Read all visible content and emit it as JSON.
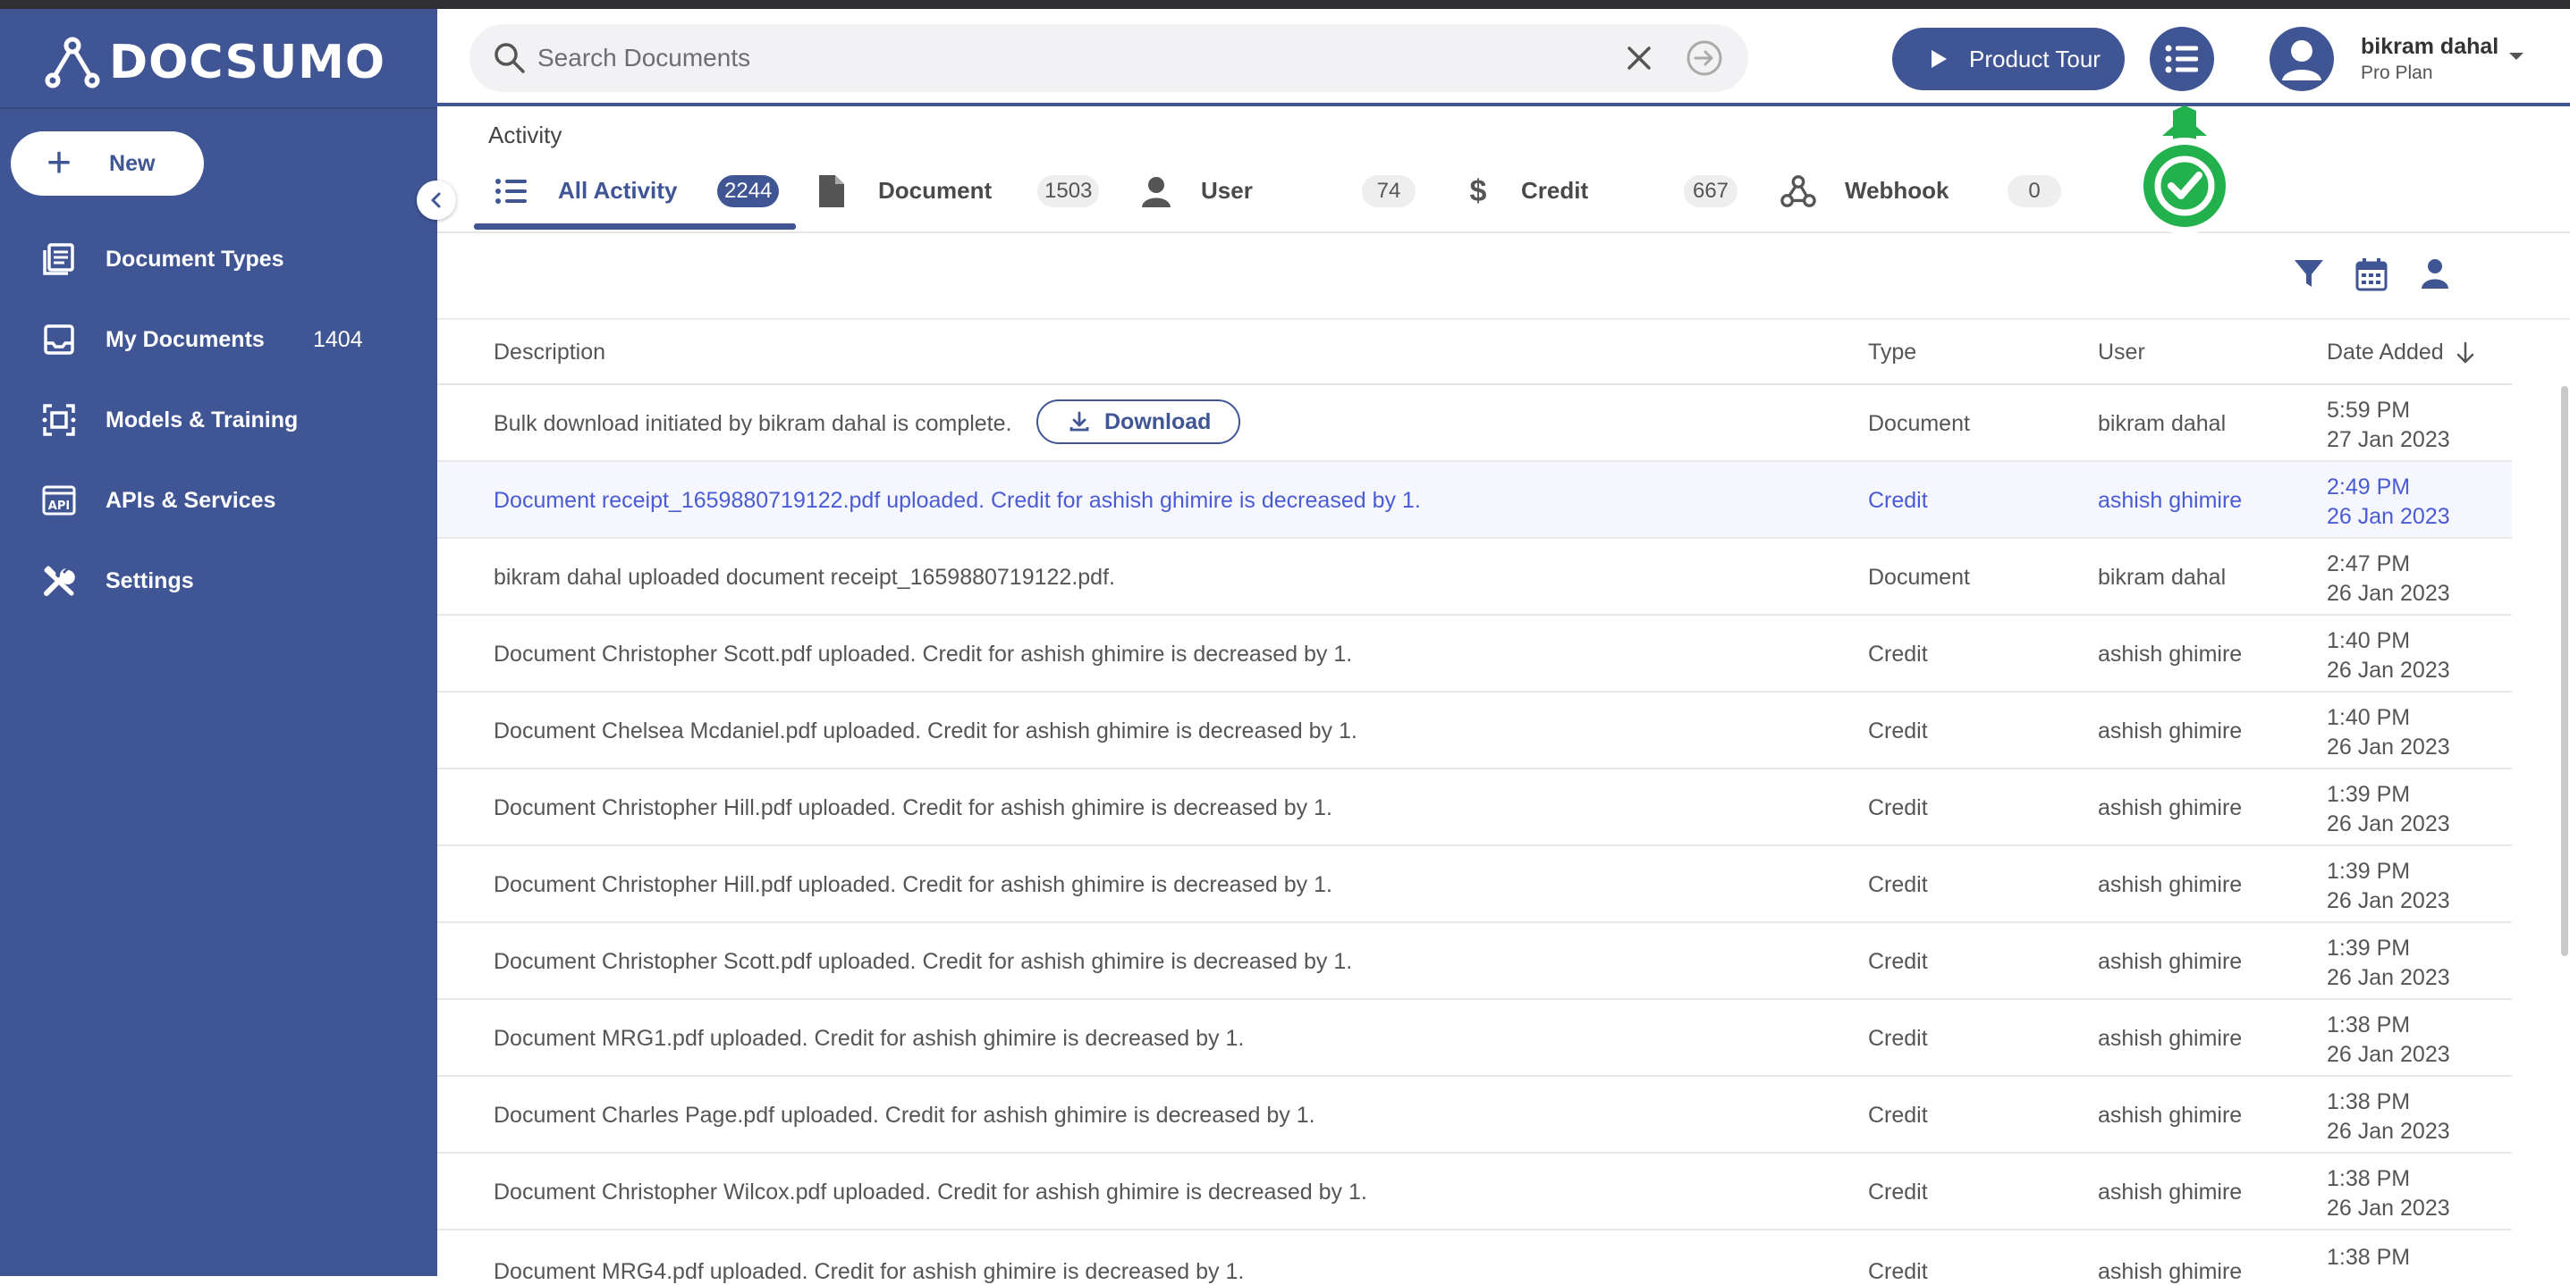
{
  "brand": {
    "name": "DOCSUMO"
  },
  "sidebar": {
    "new_label": "New",
    "items": [
      {
        "label": "Document Types",
        "icon": "document-types-icon"
      },
      {
        "label": "My Documents",
        "count": "1404",
        "icon": "inbox-icon"
      },
      {
        "label": "Models & Training",
        "icon": "model-icon"
      },
      {
        "label": "APIs & Services",
        "icon": "api-icon"
      },
      {
        "label": "Settings",
        "icon": "tools-icon"
      }
    ]
  },
  "header": {
    "search_placeholder": "Search Documents",
    "tour_label": "Product Tour",
    "user_name": "bikram dahal",
    "user_plan": "Pro Plan"
  },
  "activity": {
    "title": "Activity",
    "tabs": [
      {
        "label": "All Activity",
        "count": "2244",
        "active": true
      },
      {
        "label": "Document",
        "count": "1503"
      },
      {
        "label": "User",
        "count": "74"
      },
      {
        "label": "Credit",
        "count": "667"
      },
      {
        "label": "Webhook",
        "count": "0"
      }
    ]
  },
  "table": {
    "headers": {
      "description": "Description",
      "type": "Type",
      "user": "User",
      "date": "Date Added"
    },
    "download_label": "Download",
    "rows": [
      {
        "desc": "Bulk download initiated by bikram dahal is complete.",
        "type": "Document",
        "user": "bikram dahal",
        "time": "5:59 PM",
        "date": "27 Jan 2023"
      },
      {
        "desc": "Document receipt_1659880719122.pdf uploaded. Credit for ashish ghimire is decreased by 1.",
        "type": "Credit",
        "user": "ashish ghimire",
        "time": "2:49 PM",
        "date": "26 Jan 2023"
      },
      {
        "desc": "bikram dahal uploaded document receipt_1659880719122.pdf.",
        "type": "Document",
        "user": "bikram dahal",
        "time": "2:47 PM",
        "date": "26 Jan 2023"
      },
      {
        "desc": "Document Christopher Scott.pdf uploaded. Credit for ashish ghimire is decreased by 1.",
        "type": "Credit",
        "user": "ashish ghimire",
        "time": "1:40 PM",
        "date": "26 Jan 2023"
      },
      {
        "desc": "Document Chelsea Mcdaniel.pdf uploaded. Credit for ashish ghimire is decreased by 1.",
        "type": "Credit",
        "user": "ashish ghimire",
        "time": "1:40 PM",
        "date": "26 Jan 2023"
      },
      {
        "desc": "Document Christopher Hill.pdf uploaded. Credit for ashish ghimire is decreased by 1.",
        "type": "Credit",
        "user": "ashish ghimire",
        "time": "1:39 PM",
        "date": "26 Jan 2023"
      },
      {
        "desc": "Document Christopher Hill.pdf uploaded. Credit for ashish ghimire is decreased by 1.",
        "type": "Credit",
        "user": "ashish ghimire",
        "time": "1:39 PM",
        "date": "26 Jan 2023"
      },
      {
        "desc": "Document Christopher Scott.pdf uploaded. Credit for ashish ghimire is decreased by 1.",
        "type": "Credit",
        "user": "ashish ghimire",
        "time": "1:39 PM",
        "date": "26 Jan 2023"
      },
      {
        "desc": "Document MRG1.pdf uploaded. Credit for ashish ghimire is decreased by 1.",
        "type": "Credit",
        "user": "ashish ghimire",
        "time": "1:38 PM",
        "date": "26 Jan 2023"
      },
      {
        "desc": "Document Charles Page.pdf uploaded. Credit for ashish ghimire is decreased by 1.",
        "type": "Credit",
        "user": "ashish ghimire",
        "time": "1:38 PM",
        "date": "26 Jan 2023"
      },
      {
        "desc": "Document Christopher Wilcox.pdf uploaded. Credit for ashish ghimire is decreased by 1.",
        "type": "Credit",
        "user": "ashish ghimire",
        "time": "1:38 PM",
        "date": "26 Jan 2023"
      },
      {
        "desc": "Document MRG4.pdf uploaded. Credit for ashish ghimire is decreased by 1.",
        "type": "Credit",
        "user": "ashish ghimire",
        "time": "1:38 PM",
        "date": ""
      }
    ]
  },
  "colors": {
    "brand": "#3f5594",
    "highlight_text": "#4a5bd6",
    "success": "#22b14c"
  }
}
